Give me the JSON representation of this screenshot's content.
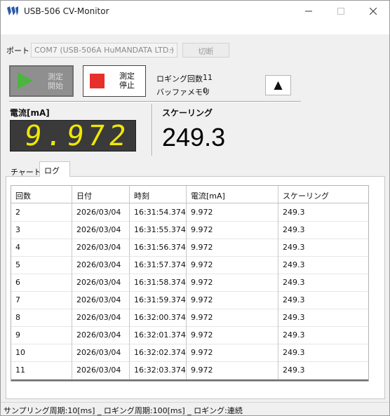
{
  "window": {
    "title": "USB-506 CV-Monitor"
  },
  "port": {
    "label": "ポート",
    "selected": "COM7 (USB-506A HuMANDATA LTD.)",
    "disconnect_label": "切断"
  },
  "controls": {
    "start_label_1": "測定",
    "start_label_2": "開始",
    "stop_label_1": "測定",
    "stop_label_2": "停止",
    "logging_count_label": "ロギング回数",
    "logging_count_value": "11",
    "buffer_memory_label": "バッファメモリ",
    "buffer_memory_value": "0",
    "up_label": "▲"
  },
  "current": {
    "label": "電流[mA]",
    "value": "9.972"
  },
  "scaling": {
    "label": "スケーリング",
    "value": "249.3"
  },
  "tabs": {
    "chart": "チャート",
    "log": "ログ",
    "active": "log"
  },
  "log_table": {
    "headers": [
      "回数",
      "日付",
      "時刻",
      "電流[mA]",
      "スケーリング"
    ],
    "rows": [
      [
        "2",
        "2026/03/04",
        "16:31:54.374",
        "9.972",
        "249.3"
      ],
      [
        "3",
        "2026/03/04",
        "16:31:55.374",
        "9.972",
        "249.3"
      ],
      [
        "4",
        "2026/03/04",
        "16:31:56.374",
        "9.972",
        "249.3"
      ],
      [
        "5",
        "2026/03/04",
        "16:31:57.374",
        "9.972",
        "249.3"
      ],
      [
        "6",
        "2026/03/04",
        "16:31:58.374",
        "9.972",
        "249.3"
      ],
      [
        "7",
        "2026/03/04",
        "16:31:59.374",
        "9.972",
        "249.3"
      ],
      [
        "8",
        "2026/03/04",
        "16:32:00.374",
        "9.972",
        "249.3"
      ],
      [
        "9",
        "2026/03/04",
        "16:32:01.374",
        "9.972",
        "249.3"
      ],
      [
        "10",
        "2026/03/04",
        "16:32:02.374",
        "9.972",
        "249.3"
      ],
      [
        "11",
        "2026/03/04",
        "16:32:03.374",
        "9.972",
        "249.3"
      ]
    ]
  },
  "status": {
    "text": "サンプリング周期:10[ms] _ ロギング周期:100[ms] _ ロギング:連続"
  },
  "icons": {
    "app": "app-logo-icon",
    "start": "play-icon",
    "stop": "stop-icon",
    "select": "chevron-down-icon"
  },
  "colors": {
    "lcd_digits": "#f0e800",
    "lcd_bg": "#3a3a3a",
    "stop_square": "#e8302a",
    "play": "#4bb53d"
  }
}
